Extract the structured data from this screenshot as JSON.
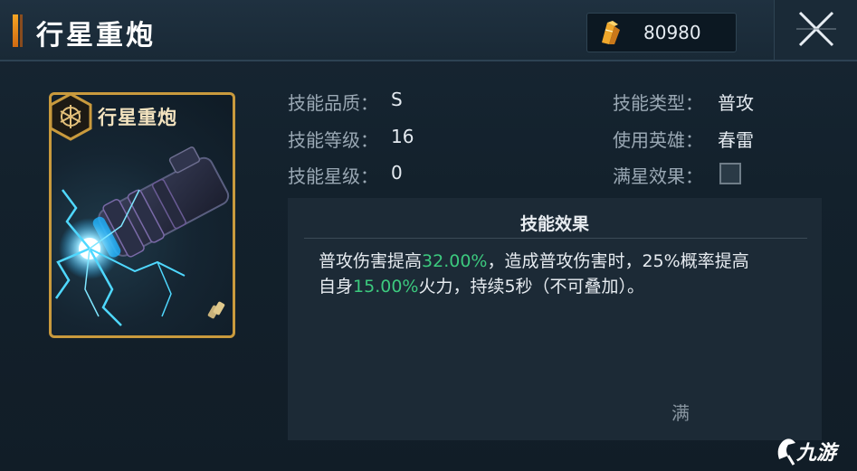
{
  "header": {
    "title": "行星重炮",
    "currency_value": "80980",
    "currency_icon": "crystal-icon",
    "close_icon": "close-icon"
  },
  "card": {
    "title": "行星重炮",
    "badge_icon": "skill-emblem-icon",
    "frame_color": "#c99a3d"
  },
  "info": {
    "quality_label": "技能品质：",
    "quality_value": "S",
    "level_label": "技能等级：",
    "level_value": "16",
    "star_label": "技能星级：",
    "star_value": "0",
    "type_label": "技能类型：",
    "type_value": "普攻",
    "hero_label": "使用英雄：",
    "hero_value": "春雷",
    "fullstar_label": "满星效果："
  },
  "effect": {
    "title": "技能效果",
    "line1_a": "普攻伤害提高",
    "line1_hl": "32.00%",
    "line1_b": "，造成普攻伤害时，25%概率提高",
    "line2_a": "自身",
    "line2_hl": "15.00%",
    "line2_b": "火力，持续5秒（不可叠加）。",
    "more": "满",
    "highlight_color": "#3cc97e"
  },
  "watermark": {
    "text": "九游"
  }
}
